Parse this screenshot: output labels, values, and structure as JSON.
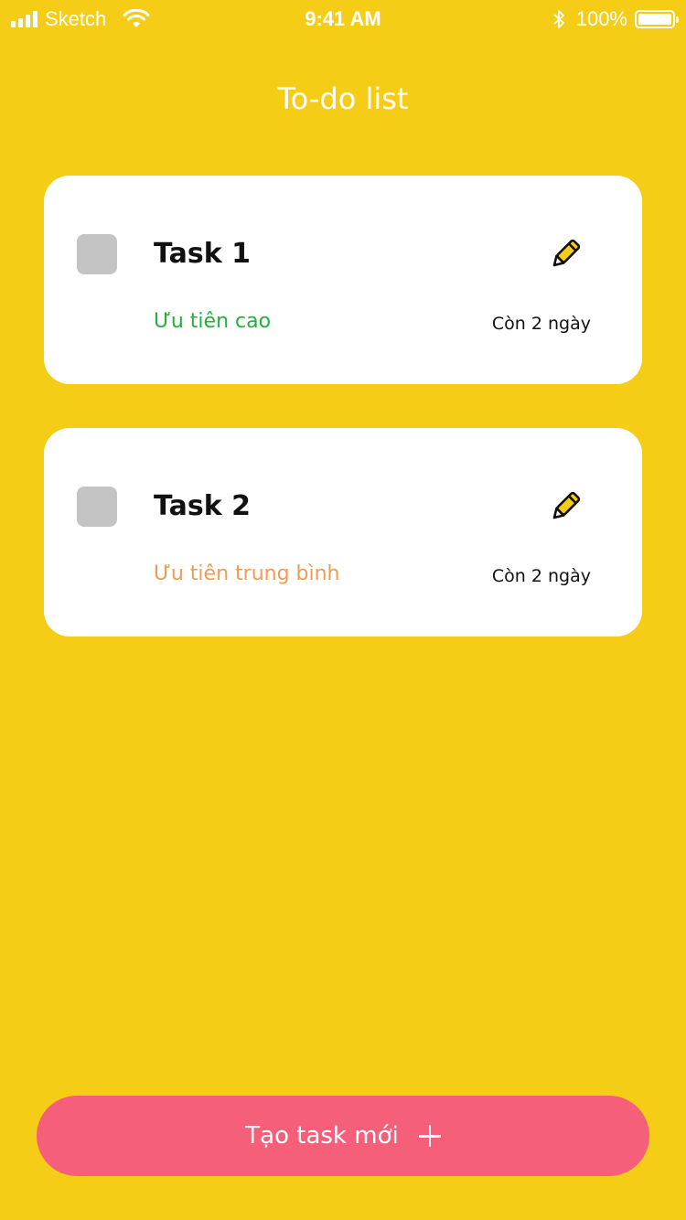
{
  "status_bar": {
    "carrier": "Sketch",
    "time": "9:41 AM",
    "battery_percent": "100%",
    "battery_level": 1.0
  },
  "header": {
    "title": "To-do list"
  },
  "tasks": [
    {
      "title": "Task 1",
      "checked": false,
      "priority": "Ưu tiên cao",
      "priority_color": "#27AE3D",
      "due": "Còn 2 ngày"
    },
    {
      "title": "Task 2",
      "checked": false,
      "priority": "Ưu tiên trung bình",
      "priority_color": "#F29B55",
      "due": "Còn 2 ngày"
    }
  ],
  "actions": {
    "create_label": "Tạo task mới"
  },
  "colors": {
    "background": "#F6CD16",
    "card": "#FFFFFF",
    "checkbox": "#C4C4C4",
    "create_button": "#F65F7A"
  },
  "icons": {
    "signal": "signal-icon",
    "wifi": "wifi-icon",
    "bluetooth": "bluetooth-icon",
    "battery": "battery-icon",
    "edit": "pencil-icon",
    "add": "plus-icon"
  }
}
